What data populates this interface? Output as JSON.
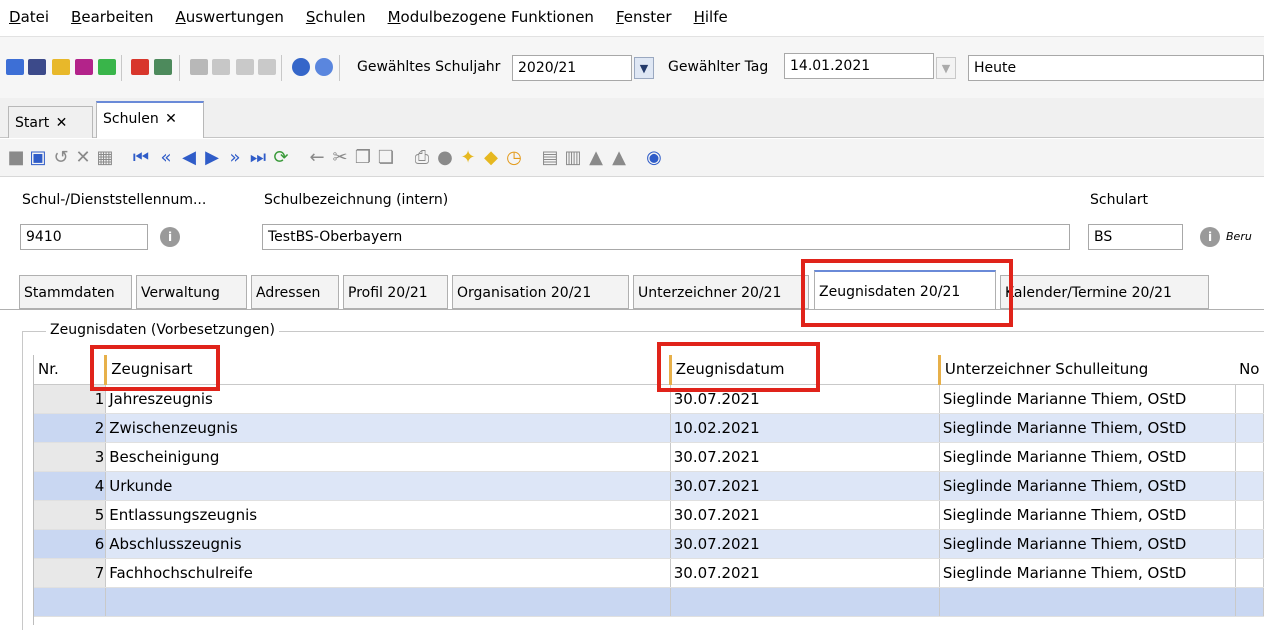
{
  "menu": [
    "Datei",
    "Bearbeiten",
    "Auswertungen",
    "Schulen",
    "Modulbezogene Funktionen",
    "Fenster",
    "Hilfe"
  ],
  "toolbar": {
    "schuljahr_label": "Gewähltes Schuljahr",
    "schuljahr_value": "2020/21",
    "tag_label": "Gewählter Tag",
    "tag_value": "14.01.2021",
    "heute_value": "Heute"
  },
  "doc_tabs": [
    {
      "label": "Start",
      "close": "✕"
    },
    {
      "label": "Schulen",
      "close": "✕"
    }
  ],
  "school": {
    "num_label": "Schul-/Dienststellennum...",
    "num_value": "9410",
    "name_label": "Schulbezeichnung (intern)",
    "name_value": "TestBS-Oberbayern",
    "art_label": "Schulart",
    "art_value": "BS",
    "art_desc": "Beru"
  },
  "form_tabs": [
    "Stammdaten",
    "Verwaltung",
    "Adressen",
    "Profil 20/21",
    "Organisation 20/21",
    "Unterzeichner 20/21",
    "Zeugnisdaten 20/21",
    "Kalender/Termine 20/21"
  ],
  "group_label": "Zeugnisdaten (Vorbesetzungen)",
  "grid": {
    "columns": [
      "Nr.",
      "Zeugnisart",
      "Zeugnisdatum",
      "Unterzeichner Schulleitung",
      "No"
    ],
    "rows": [
      {
        "nr": "1",
        "art": "Jahreszeugnis",
        "datum": "30.07.2021",
        "unterzeichner": "Sieglinde Marianne Thiem, OStD"
      },
      {
        "nr": "2",
        "art": "Zwischenzeugnis",
        "datum": "10.02.2021",
        "unterzeichner": "Sieglinde Marianne Thiem, OStD"
      },
      {
        "nr": "3",
        "art": "Bescheinigung",
        "datum": "30.07.2021",
        "unterzeichner": "Sieglinde Marianne Thiem, OStD"
      },
      {
        "nr": "4",
        "art": "Urkunde",
        "datum": "30.07.2021",
        "unterzeichner": "Sieglinde Marianne Thiem, OStD"
      },
      {
        "nr": "5",
        "art": "Entlassungszeugnis",
        "datum": "30.07.2021",
        "unterzeichner": "Sieglinde Marianne Thiem, OStD"
      },
      {
        "nr": "6",
        "art": "Abschlusszeugnis",
        "datum": "30.07.2021",
        "unterzeichner": "Sieglinde Marianne Thiem, OStD"
      },
      {
        "nr": "7",
        "art": "Fachhochschulreife",
        "datum": "30.07.2021",
        "unterzeichner": "Sieglinde Marianne Thiem, OStD"
      }
    ]
  },
  "colors": {
    "highlight": "#e0231a",
    "row_alt": "#dde6f7",
    "accent": "#2f5cc8"
  }
}
